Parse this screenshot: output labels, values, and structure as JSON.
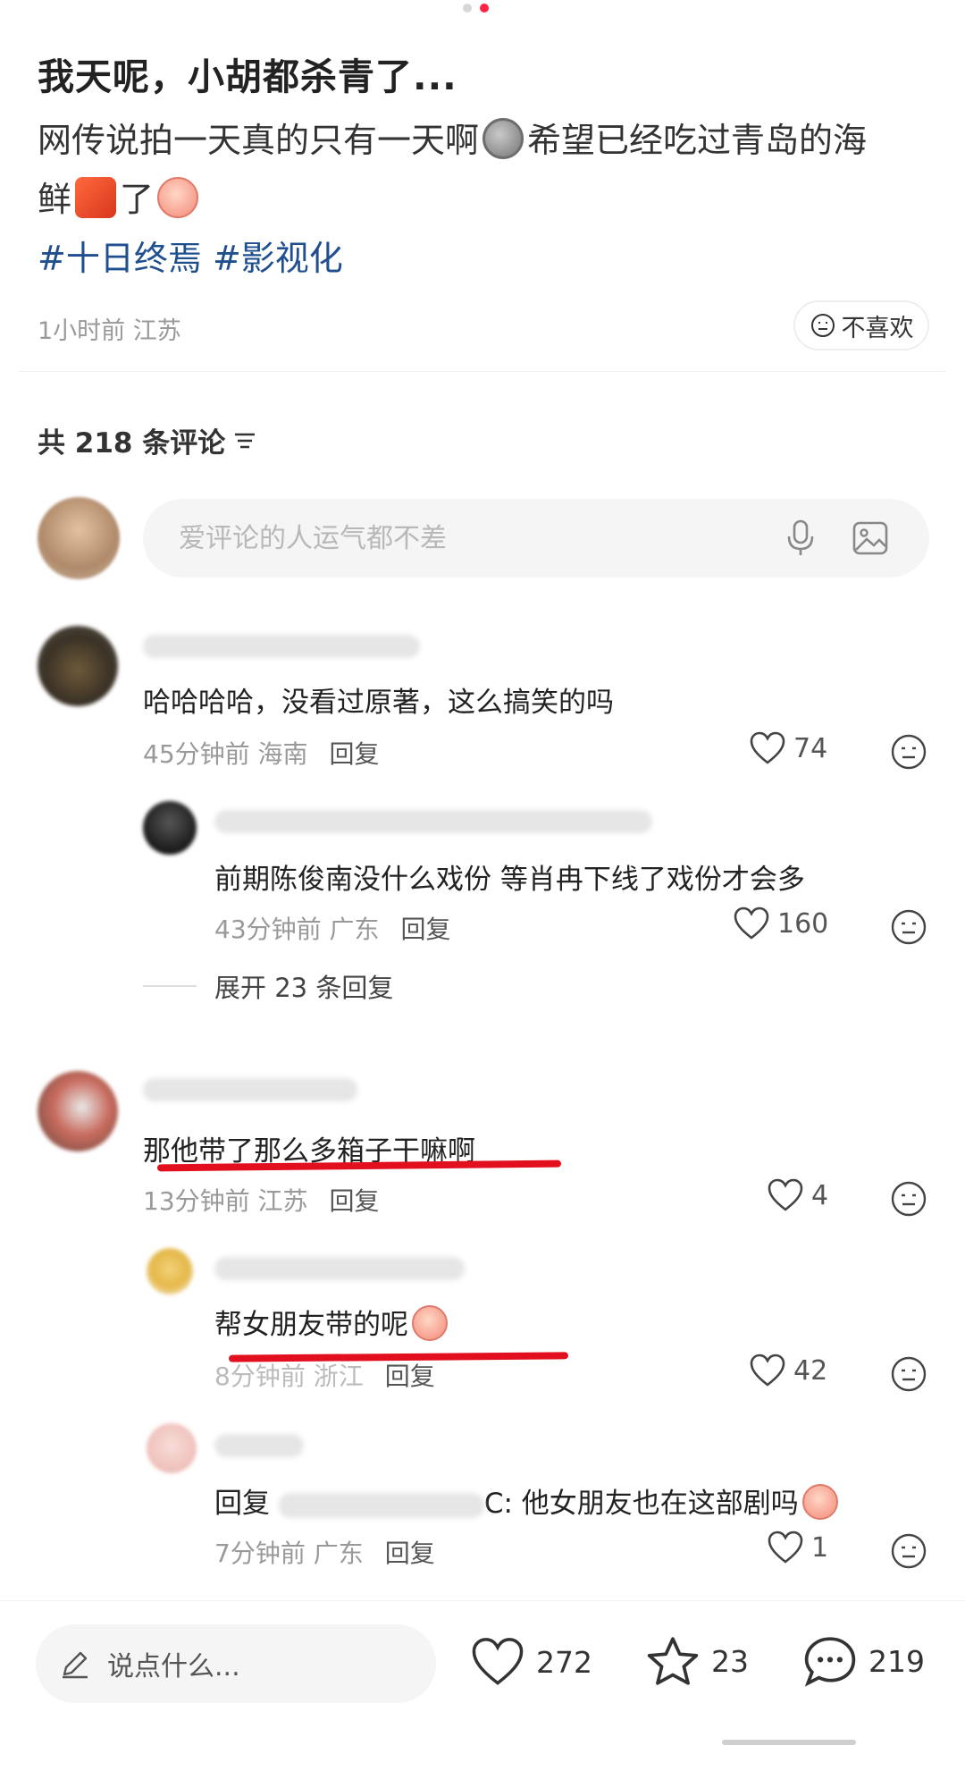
{
  "post": {
    "title": "我天呢，小胡都杀青了...",
    "body_line1_a": "网传说拍一天真的只有一天啊",
    "body_line1_b": "希望已经吃过青岛的海",
    "body_line2_a": "鲜",
    "body_line2_b": "了",
    "hashtag1": "#十日终焉",
    "hashtag2": "#影视化",
    "meta": "1小时前 江苏",
    "dislike_label": "不喜欢"
  },
  "comments_header": {
    "label": "共 218 条评论"
  },
  "comment_input": {
    "placeholder": "爱评论的人运气都不差"
  },
  "comments": [
    {
      "text": "哈哈哈哈，没看过原著，这么搞笑的吗",
      "time": "45分钟前 海南",
      "reply": "回复",
      "likes": "74"
    },
    {
      "text": "前期陈俊南没什么戏份 等肖冉下线了戏份才会多",
      "time": "43分钟前 广东",
      "reply": "回复",
      "likes": "160"
    },
    {
      "text": "那他带了那么多箱子干嘛啊",
      "time": "13分钟前 江苏",
      "reply": "回复",
      "likes": "4"
    },
    {
      "text": "帮女朋友带的呢",
      "time": "8分钟前 浙江",
      "reply": "回复",
      "likes": "42"
    },
    {
      "text_prefix": "回复 ",
      "text": "C: 他女朋友也在这部剧吗",
      "time": "7分钟前 广东",
      "reply": "回复",
      "likes": "1"
    }
  ],
  "expand_replies": {
    "label": "展开 23 条回复"
  },
  "bottom": {
    "say_placeholder": "说点什么...",
    "likes": "272",
    "stars": "23",
    "comments": "219"
  },
  "colors": {
    "accent": "#ff2442",
    "hashtag": "#1f4f8f",
    "highlight": "#e2101e"
  },
  "icons": [
    "heart-icon",
    "star-icon",
    "chat-bubble-icon",
    "pencil-icon",
    "microphone-icon",
    "image-icon",
    "meh-face-icon",
    "filter-icon"
  ]
}
